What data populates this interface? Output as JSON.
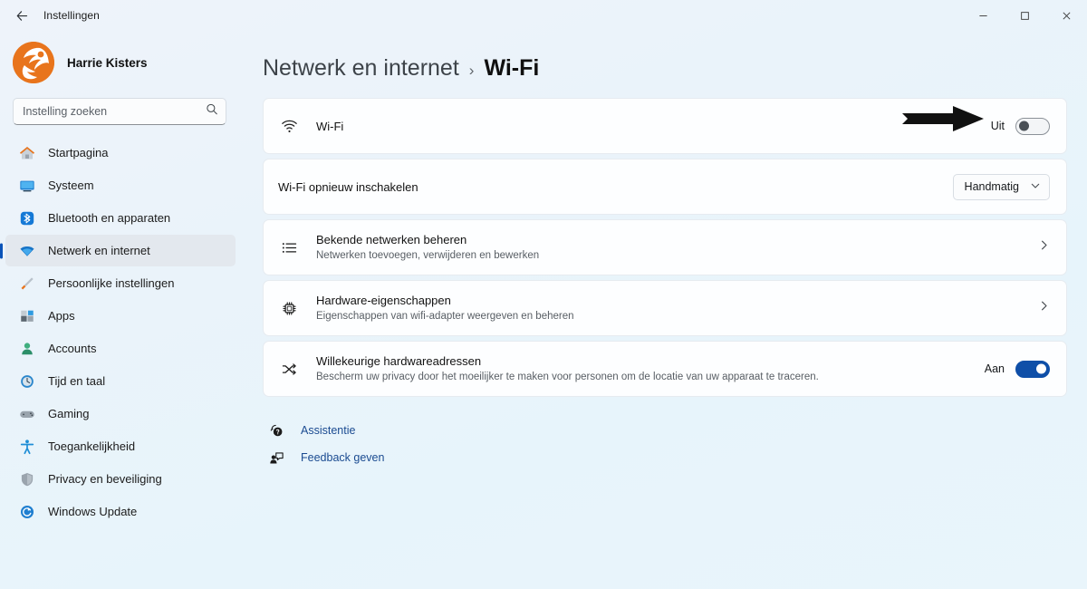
{
  "titlebar": {
    "back_label": "back-arrow",
    "title": "Instellingen",
    "minimize": "–",
    "maximize": "□",
    "close": "✕"
  },
  "sidebar": {
    "profile": {
      "name": "Harrie Kisters",
      "avatar": "orange-logo-avatar"
    },
    "search": {
      "placeholder": "Instelling zoeken",
      "value": "",
      "icon": "search-icon"
    },
    "items": [
      {
        "label": "Startpagina",
        "icon": "home-icon",
        "selected": false
      },
      {
        "label": "Systeem",
        "icon": "monitor-icon",
        "selected": false
      },
      {
        "label": "Bluetooth en apparaten",
        "icon": "bluetooth-icon",
        "selected": false
      },
      {
        "label": "Netwerk en internet",
        "icon": "wifi-icon",
        "selected": true
      },
      {
        "label": "Persoonlijke instellingen",
        "icon": "paintbrush-icon",
        "selected": false
      },
      {
        "label": "Apps",
        "icon": "apps-icon",
        "selected": false
      },
      {
        "label": "Accounts",
        "icon": "person-icon",
        "selected": false
      },
      {
        "label": "Tijd en taal",
        "icon": "clock-globe-icon",
        "selected": false
      },
      {
        "label": "Gaming",
        "icon": "gamepad-icon",
        "selected": false
      },
      {
        "label": "Toegankelijkheid",
        "icon": "accessibility-icon",
        "selected": false
      },
      {
        "label": "Privacy en beveiliging",
        "icon": "shield-icon",
        "selected": false
      },
      {
        "label": "Windows Update",
        "icon": "update-icon",
        "selected": false
      }
    ]
  },
  "main": {
    "breadcrumb": {
      "parent": "Netwerk en internet",
      "separator": "›",
      "current": "Wi-Fi"
    },
    "wifi_row": {
      "icon": "wifi-icon",
      "title": "Wi-Fi",
      "state_label": "Uit",
      "toggle_state": "off",
      "annotation": "black-right-arrow"
    },
    "reenable_row": {
      "title": "Wi-Fi opnieuw inschakelen",
      "dropdown_value": "Handmatig",
      "dropdown_icon": "chevron-down-icon"
    },
    "known_networks_row": {
      "icon": "list-icon",
      "title": "Bekende netwerken beheren",
      "subtitle": "Netwerken toevoegen, verwijderen en bewerken",
      "chevron": "chevron-right-icon"
    },
    "hardware_row": {
      "icon": "chip-icon",
      "title": "Hardware-eigenschappen",
      "subtitle": "Eigenschappen van wifi-adapter weergeven en beheren",
      "chevron": "chevron-right-icon"
    },
    "random_mac_row": {
      "icon": "shuffle-icon",
      "title": "Willekeurige hardwareadressen",
      "subtitle": "Bescherm uw privacy door het moeilijker te maken voor personen om de locatie van uw apparaat te traceren.",
      "state_label": "Aan",
      "toggle_state": "on"
    },
    "links": [
      {
        "label": "Assistentie",
        "icon": "help-icon"
      },
      {
        "label": "Feedback geven",
        "icon": "feedback-icon"
      }
    ]
  },
  "colors": {
    "accent": "#0f4fa8",
    "link": "#1b4b91",
    "avatar_orange": "#e8741c",
    "selected_nav": "#e3e8ee"
  }
}
